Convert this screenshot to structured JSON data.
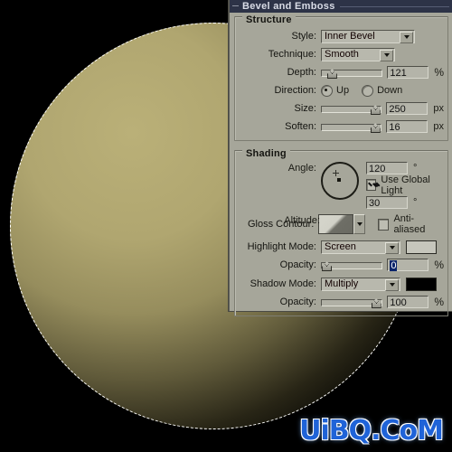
{
  "canvas": {
    "artwork_name": "beveled-sphere",
    "background_color": "#000000",
    "sphere_highlight_color": "#bab078",
    "sphere_shadow_color": "#000000",
    "selection_style": "dashed-marquee"
  },
  "dialog": {
    "title": "Bevel and Emboss",
    "groups": {
      "structure": {
        "title": "Structure",
        "style": {
          "label": "Style:",
          "value": "Inner Bevel"
        },
        "technique": {
          "label": "Technique:",
          "value": "Smooth"
        },
        "depth": {
          "label": "Depth:",
          "value": "121",
          "unit": "%",
          "slider_percent": 12
        },
        "direction": {
          "label": "Direction:",
          "options": [
            "Up",
            "Down"
          ],
          "selected": "Up"
        },
        "size": {
          "label": "Size:",
          "value": "250",
          "unit": "px",
          "slider_percent": 97
        },
        "soften": {
          "label": "Soften:",
          "value": "16",
          "unit": "px",
          "slider_percent": 97
        }
      },
      "shading": {
        "title": "Shading",
        "angle": {
          "label": "Angle:",
          "value": "120",
          "unit": "°"
        },
        "use_global_light": {
          "label": "Use Global Light",
          "checked": true
        },
        "altitude": {
          "label": "Altitude:",
          "value": "30",
          "unit": "°"
        },
        "gloss_contour": {
          "label": "Gloss Contour:",
          "preset": "linear-ramp"
        },
        "anti_aliased": {
          "label": "Anti-aliased",
          "checked": false
        },
        "highlight_mode": {
          "label": "Highlight Mode:",
          "value": "Screen",
          "color": "#c6c6bc"
        },
        "highlight_opacity": {
          "label": "Opacity:",
          "value": "0",
          "unit": "%",
          "slider_percent": 2,
          "selected": true
        },
        "shadow_mode": {
          "label": "Shadow Mode:",
          "value": "Multiply",
          "color": "#000000"
        },
        "shadow_opacity": {
          "label": "Opacity:",
          "value": "100",
          "unit": "%",
          "slider_percent": 97
        }
      }
    }
  },
  "watermark": {
    "text": "UiBQ.CoM",
    "color": "#1f63d8"
  }
}
